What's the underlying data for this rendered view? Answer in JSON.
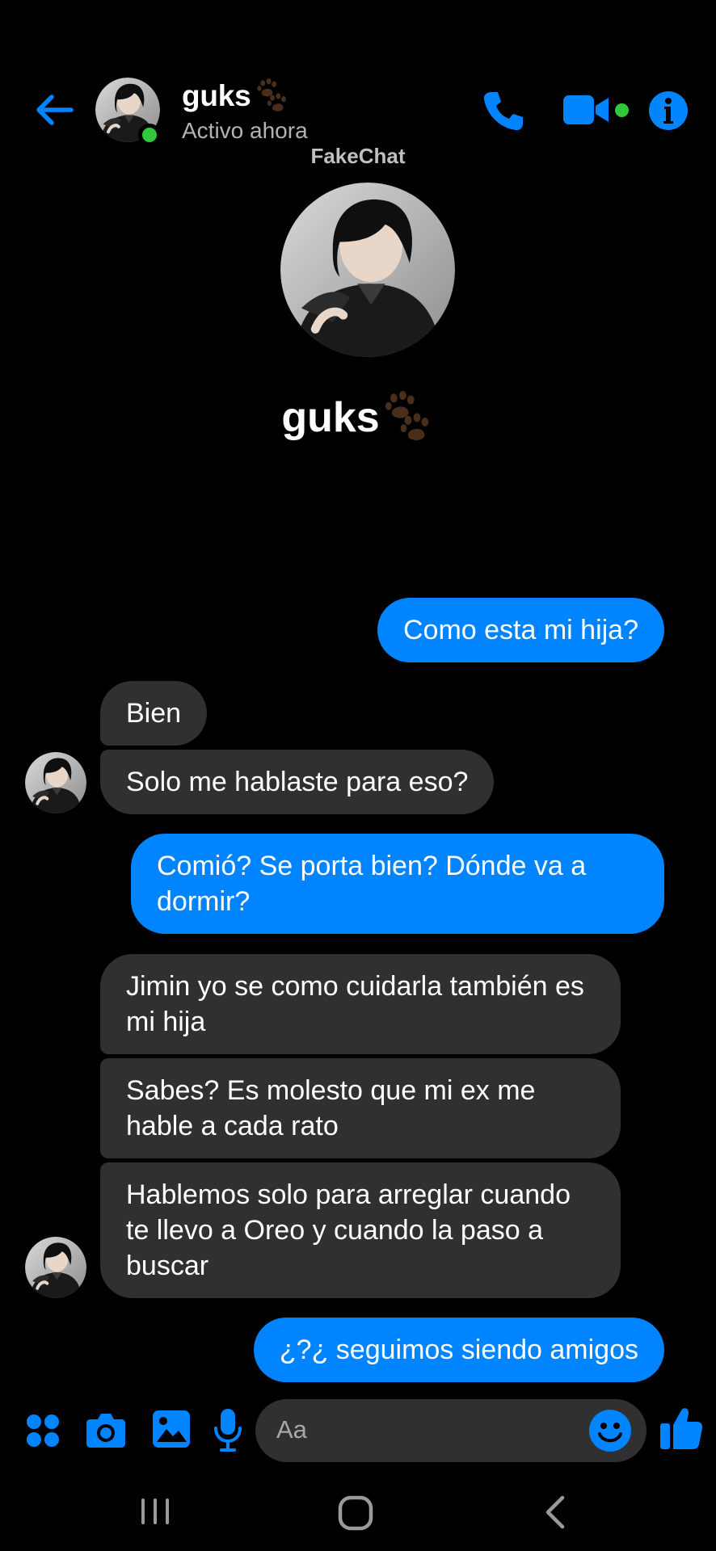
{
  "header": {
    "contact_name": "guks",
    "status": "Activo ahora"
  },
  "watermark": "FakeChat",
  "profile": {
    "name": "guks"
  },
  "messages": [
    {
      "side": "out",
      "text": "Como esta mi hija?"
    },
    {
      "side": "in",
      "text": "Bien"
    },
    {
      "side": "in",
      "text": "Solo me hablaste para eso?"
    },
    {
      "side": "out",
      "text": "Comió? Se porta bien? Dónde va a dormir?"
    },
    {
      "side": "in",
      "text": "Jimin yo se como cuidarla también es mi hija"
    },
    {
      "side": "in",
      "text": "Sabes? Es molesto que mi ex me hable a cada rato"
    },
    {
      "side": "in",
      "text": "Hablemos solo para arreglar cuando te llevo a Oreo y cuando la paso a buscar"
    },
    {
      "side": "out",
      "text": "¿?¿ seguimos siendo amigos"
    }
  ],
  "composer": {
    "placeholder": "Aa"
  },
  "icons": {
    "header": [
      "back-arrow-icon",
      "phone-icon",
      "video-camera-icon",
      "info-icon",
      "paw-prints-icon"
    ],
    "composer": [
      "apps-icon",
      "camera-icon",
      "gallery-icon",
      "microphone-icon",
      "emoji-icon",
      "thumbs-up-icon"
    ],
    "system_nav": [
      "recents-icon",
      "home-icon",
      "back-chevron-icon"
    ]
  },
  "colors": {
    "accent": "#0084ff",
    "incoming_bubble": "#303030",
    "background": "#000000",
    "online": "#31c93b",
    "secondary_text": "#b0b3b8"
  }
}
